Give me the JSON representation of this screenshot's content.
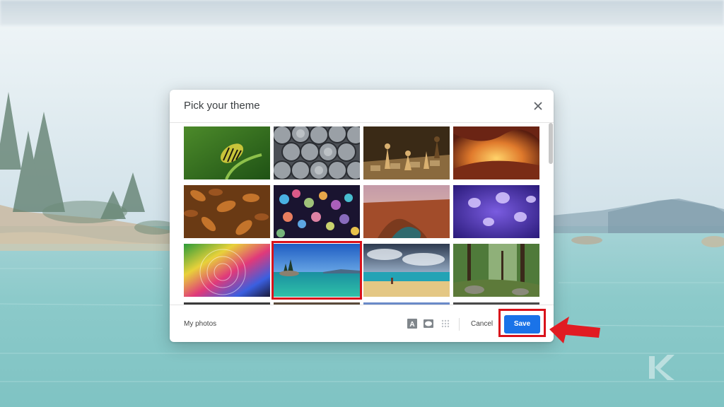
{
  "dialog": {
    "title": "Pick your theme",
    "close_icon": "close-icon"
  },
  "themes": [
    {
      "name": "caterpillar"
    },
    {
      "name": "pipes"
    },
    {
      "name": "chess"
    },
    {
      "name": "canyon-glow"
    },
    {
      "name": "autumn-leaves"
    },
    {
      "name": "bokeh"
    },
    {
      "name": "canyon-river"
    },
    {
      "name": "jellyfish"
    },
    {
      "name": "rainbow-droplet"
    },
    {
      "name": "lake-tahoe",
      "selected": true
    },
    {
      "name": "beach"
    },
    {
      "name": "forest"
    }
  ],
  "footer": {
    "my_photos": "My photos",
    "cancel": "Cancel",
    "save": "Save",
    "icons": [
      "text-background-icon",
      "vignette-icon",
      "blur-icon"
    ]
  },
  "colors": {
    "accent": "#1a73e8",
    "highlight": "#d9121b"
  }
}
